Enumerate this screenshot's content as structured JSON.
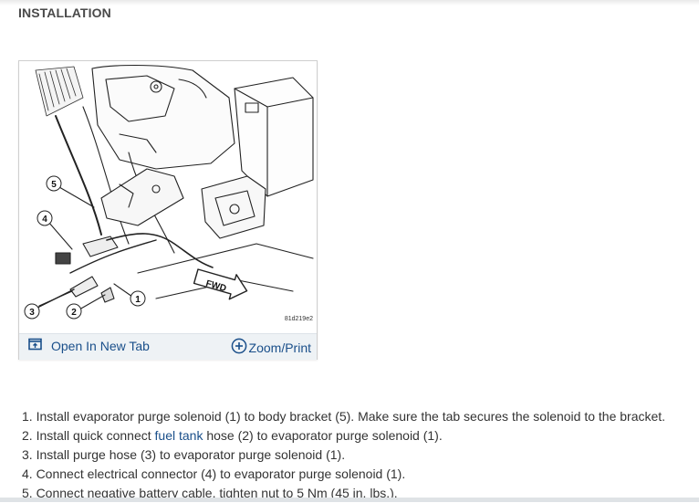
{
  "section": {
    "heading": "INSTALLATION"
  },
  "figure": {
    "figure_id": "81d219e2",
    "callouts": [
      "1",
      "2",
      "3",
      "4",
      "5"
    ],
    "direction_label": "FWD",
    "open_tab_label": "Open In New Tab",
    "zoom_label": "Zoom/Print"
  },
  "steps": [
    {
      "text": "1. Install evaporator purge solenoid (1) to body bracket (5). Make sure the tab secures the solenoid to the bracket."
    },
    {
      "pre": "2. Install quick connect ",
      "link": "fuel tank",
      "post": " hose (2) to evaporator purge solenoid (1)."
    },
    {
      "text": "3. Install purge hose (3) to evaporator purge solenoid (1)."
    },
    {
      "text": "4. Connect electrical connector (4) to evaporator purge solenoid (1)."
    },
    {
      "text": "5. Connect negative battery cable, tighten nut to 5 Nm (45 in. lbs.)."
    }
  ],
  "colors": {
    "link": "#1a4f8a",
    "toolbar_bg": "#eef2f5"
  },
  "icons": {
    "open_tab": "open-in-new-tab-icon",
    "zoom": "zoom-plus-icon"
  }
}
